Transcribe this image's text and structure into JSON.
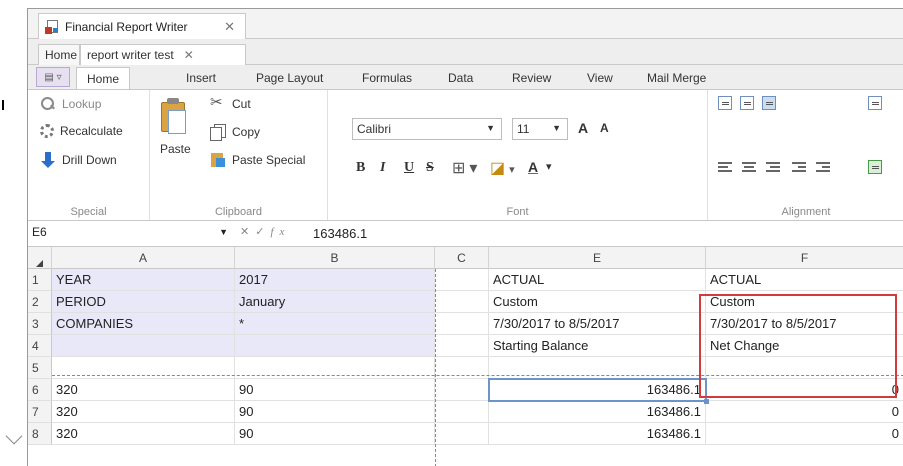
{
  "app": {
    "window_tab": "Financial Report Writer",
    "close_glyph": "✕"
  },
  "sheet_tabs": [
    {
      "label": "Home"
    },
    {
      "label": "report writer test"
    }
  ],
  "ribbon_tabs": [
    "Home",
    "Insert",
    "Page Layout",
    "Formulas",
    "Data",
    "Review",
    "View",
    "Mail Merge"
  ],
  "ribbon": {
    "special": {
      "caption": "Special",
      "lookup": "Lookup",
      "recalculate": "Recalculate",
      "drill_down": "Drill Down"
    },
    "clipboard": {
      "caption": "Clipboard",
      "paste": "Paste",
      "cut": "Cut",
      "copy": "Copy",
      "paste_special": "Paste Special"
    },
    "font": {
      "caption": "Font",
      "font_name": "Calibri",
      "font_size": "11",
      "grow": "A",
      "shrink": "A",
      "bold": "B",
      "italic": "I",
      "underline": "U",
      "strike": "S",
      "font_color": "A"
    },
    "alignment": {
      "caption": "Alignment"
    }
  },
  "formula_bar": {
    "name_box": "E6",
    "value": "163486.1"
  },
  "columns": [
    "A",
    "B",
    "C",
    "E",
    "F"
  ],
  "rows": [
    {
      "n": "1",
      "A": "YEAR",
      "B": "2017",
      "E": "ACTUAL",
      "F": "ACTUAL"
    },
    {
      "n": "2",
      "A": "PERIOD",
      "B": "January",
      "E": "Custom",
      "F": "Custom"
    },
    {
      "n": "3",
      "A": "COMPANIES",
      "B": "*",
      "E": "7/30/2017 to 8/5/2017",
      "F": "7/30/2017 to 8/5/2017"
    },
    {
      "n": "4",
      "A": "",
      "B": "",
      "E": "Starting Balance",
      "F": "Net Change"
    },
    {
      "n": "5",
      "A": "",
      "B": "",
      "E": "",
      "F": ""
    },
    {
      "n": "6",
      "A": "320",
      "B": "90",
      "E": "163486.1",
      "F": "0"
    },
    {
      "n": "7",
      "A": "320",
      "B": "90",
      "E": "163486.1",
      "F": "0"
    },
    {
      "n": "8",
      "A": "320",
      "B": "90",
      "E": "163486.1",
      "F": "0"
    }
  ],
  "colors": {
    "highlight_box": "#d43a3a",
    "selection": "#6b95c8",
    "header_block": "#e8e8f8"
  }
}
